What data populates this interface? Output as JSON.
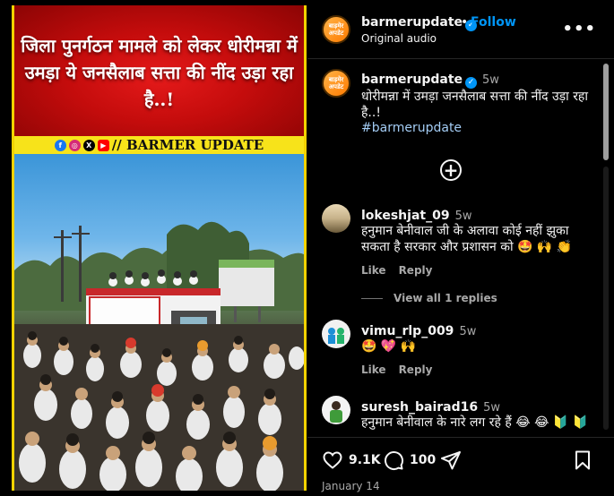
{
  "media": {
    "headline": "जिला पुनर्गठन मामले को लेकर धोरीमन्ना में उमड़ा ये जनसैलाब सत्ता की नींद उड़ा रहा है..!",
    "strip_text": "// BARMER UPDATE",
    "protest_banner": "धरना एवं विरोध प्रदर्शन"
  },
  "header": {
    "username": "barmerupdate",
    "separator": "•",
    "follow_label": "Follow",
    "audio": "Original audio",
    "avatar_text": "बाड़मेर अपडेट"
  },
  "caption": {
    "username": "barmerupdate",
    "time": "5w",
    "text": "धोरीमन्ना में उमड़ा जनसैलाब सत्ता की नींद उड़ा रहा है..!",
    "hashtag": "#barmerupdate"
  },
  "load_more_label": "+",
  "comments": [
    {
      "username": "lokeshjat_09",
      "time": "5w",
      "text": "हनुमान बेनीवाल जी के अलावा कोई नहीं झुका सकता है सरकार और प्रशासन को 🤩 🙌 👏",
      "like": "Like",
      "reply": "Reply",
      "replies": "View all 1 replies"
    },
    {
      "username": "vimu_rlp_009",
      "time": "5w",
      "text": "🤩 💖 🙌",
      "like": "Like",
      "reply": "Reply"
    },
    {
      "username": "suresh_bairad16",
      "time": "5w",
      "text": "हनुमान बेनीवाल के नारे लग रहे हैं 😂 😂 🔰 🔰"
    }
  ],
  "actions": {
    "likes": "9.1K",
    "comments": "100",
    "date": "January 14"
  },
  "colors": {
    "accent": "#0095f6",
    "banner_red": "#c40c0c",
    "strip_yellow": "#f7e31a"
  }
}
